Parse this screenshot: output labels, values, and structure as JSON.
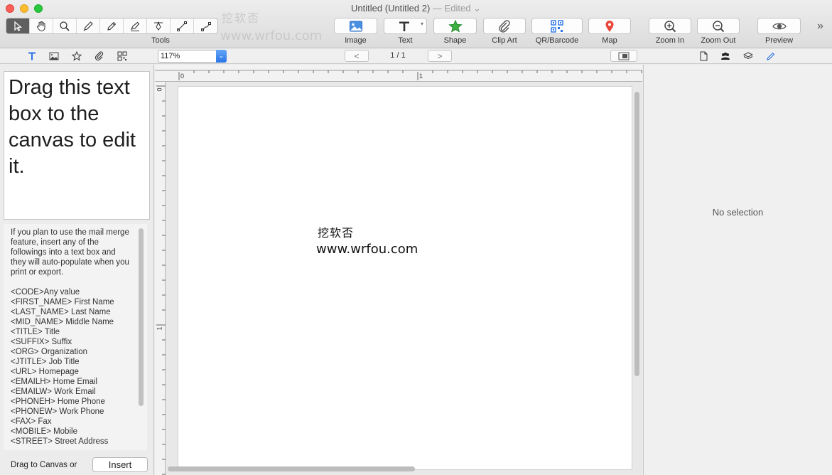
{
  "window": {
    "title": "Untitled (Untitled 2)",
    "edited": "— Edited ⌄"
  },
  "toolbar": {
    "tools_label": "Tools",
    "image_label": "Image",
    "text_label": "Text",
    "shape_label": "Shape",
    "clipart_label": "Clip Art",
    "qr_label": "QR/Barcode",
    "map_label": "Map",
    "zoom_in_label": "Zoom In",
    "zoom_out_label": "Zoom Out",
    "preview_label": "Preview",
    "more": "»",
    "watermark_cn": "挖软否",
    "watermark_url": "www.wrfou.com"
  },
  "subbar": {
    "zoom_value": "117%",
    "page_indicator": "1 / 1",
    "prev": "<",
    "next": ">"
  },
  "left_panel": {
    "sample_text": "Drag this text box to the canvas to edit it.",
    "intro": "If you plan to use the mail merge feature, insert any of the followings into a text box and they will auto-populate when you print or export.",
    "fields": [
      "<CODE>Any value",
      "<FIRST_NAME> First Name",
      "<LAST_NAME> Last Name",
      "<MID_NAME> Middle Name",
      "<TITLE> Title",
      "<SUFFIX> Suffix",
      "<ORG> Organization",
      "<JTITLE> Job Title",
      "<URL> Homepage",
      "<EMAILH> Home Email",
      "<EMAILW> Work Email",
      "<PHONEH> Home Phone",
      "<PHONEW> Work Phone",
      "<FAX> Fax",
      "<MOBILE> Mobile",
      "<STREET> Street Address"
    ],
    "drag_label": "Drag to Canvas or",
    "insert_label": "Insert"
  },
  "canvas": {
    "ruler_top_0": "0",
    "ruler_top_1": "1",
    "ruler_left_0": "0",
    "ruler_left_1": "1",
    "watermark_cn": "挖软否",
    "watermark_url": "www.wrfou.com"
  },
  "inspector": {
    "no_selection": "No selection"
  },
  "colors": {
    "accent": "#2b74e6",
    "shape_green": "#3cb043",
    "map_red": "#e8473a",
    "image_blue": "#3f8ee8"
  }
}
